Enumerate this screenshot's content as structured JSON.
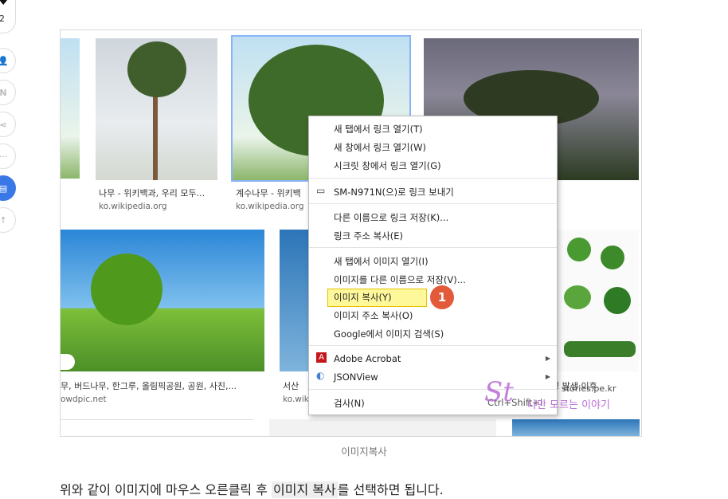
{
  "rail": {
    "like_count": "2",
    "icons": [
      "heart-icon",
      "user-icon",
      "n-icon",
      "share-icon",
      "more-icon",
      "print-icon",
      "up-icon"
    ]
  },
  "results": [
    {
      "caption": "나무 - 위키백과, 우리 모두...",
      "source": "ko.wikipedia.org"
    },
    {
      "caption": "계수나무 - 위키백",
      "source": "ko.wikipedia.org"
    },
    {
      "caption": "무, 버드나무, 한그루, 올림픽공원, 공원, 사진,...",
      "source": "owdpic.net"
    },
    {
      "caption": "서산 ",
      "source": "ko.wik"
    },
    {
      "caption": "문명 발생 이후"
    }
  ],
  "menu": {
    "items": [
      "새 탭에서 링크 열기(T)",
      "새 창에서 링크 열기(W)",
      "시크릿 창에서 링크 열기(G)",
      "SM-N971N(으)로 링크 보내기",
      "다른 이름으로 링크 저장(K)...",
      "링크 주소 복사(E)",
      "새 탭에서 이미지 열기(I)",
      "이미지를 다른 이름으로 저장(V)...",
      "이미지 복사(Y)",
      "이미지 주소 복사(O)",
      "Google에서 이미지 검색(S)",
      "Adobe Acrobat",
      "JSONView",
      "검사(N)"
    ],
    "shortcut": "Ctrl+Shift+I",
    "step_badge": "1"
  },
  "watermark": {
    "logo": "St",
    "site": "stories.pe.kr",
    "tagline": "나만 모르는 이야기"
  },
  "figure_caption": "이미지복사",
  "body": {
    "before": "위와 같이 이미지에 마우스 오른클릭 후 ",
    "highlight": "이미지  복사",
    "after": "를 선택하면 됩니다."
  },
  "colors": {
    "accent": "#3b78e7",
    "highlight": "#fff89a",
    "badge": "#e25a3a",
    "watermark": "#b96bd6"
  }
}
